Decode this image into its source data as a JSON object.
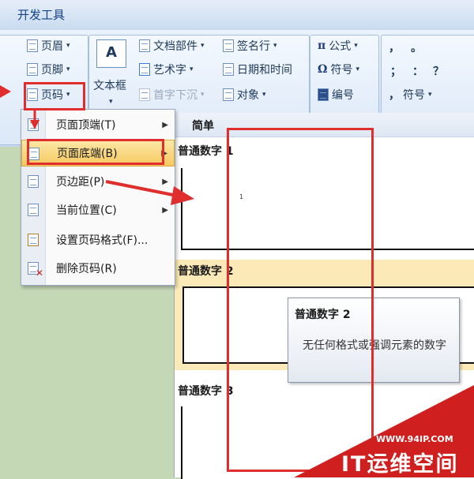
{
  "tabs": {
    "active": "开发工具"
  },
  "ribbon": {
    "header_footer": {
      "header": "页眉",
      "footer": "页脚",
      "page_number": "页码"
    },
    "text": {
      "textbox": "文本框",
      "quick_parts": "文档部件",
      "wordart": "艺术字",
      "dropcap": "首字下沉",
      "signature_line": "签名行",
      "date_time": "日期和时间",
      "object": "对象"
    },
    "symbols": {
      "equation": "公式",
      "symbol": "符号",
      "numbering": "编号"
    },
    "special": {
      "c1": "，",
      "c2": "。",
      "c3": "；",
      "c4": "：",
      "c5": "？",
      "label": "符号",
      "dot": "，"
    },
    "textbox_icon_letter": "A"
  },
  "menu": {
    "items": [
      {
        "label": "页面顶端(T)",
        "has_sub": true
      },
      {
        "label": "页面底端(B)",
        "has_sub": true
      },
      {
        "label": "页边距(P)",
        "has_sub": true
      },
      {
        "label": "当前位置(C)",
        "has_sub": true
      },
      {
        "label": "设置页码格式(F)...",
        "has_sub": false
      },
      {
        "label": "删除页码(R)",
        "has_sub": false
      }
    ],
    "submenu_arrow": "▶"
  },
  "gallery": {
    "header": "简单",
    "sections": [
      "普通数字 1",
      "普通数字 2",
      "普通数字 3"
    ],
    "sample_number": "1"
  },
  "tooltip": {
    "title": "普通数字 2",
    "description": "无任何格式或强调元素的数字"
  },
  "watermark": {
    "url": "WWW.94IP.COM",
    "text": "IT运维空间"
  },
  "colors": {
    "annotation_red": "#e02d2d",
    "hover_gold": "#f6c95f",
    "ribbon_blue": "#d5e3f5"
  }
}
